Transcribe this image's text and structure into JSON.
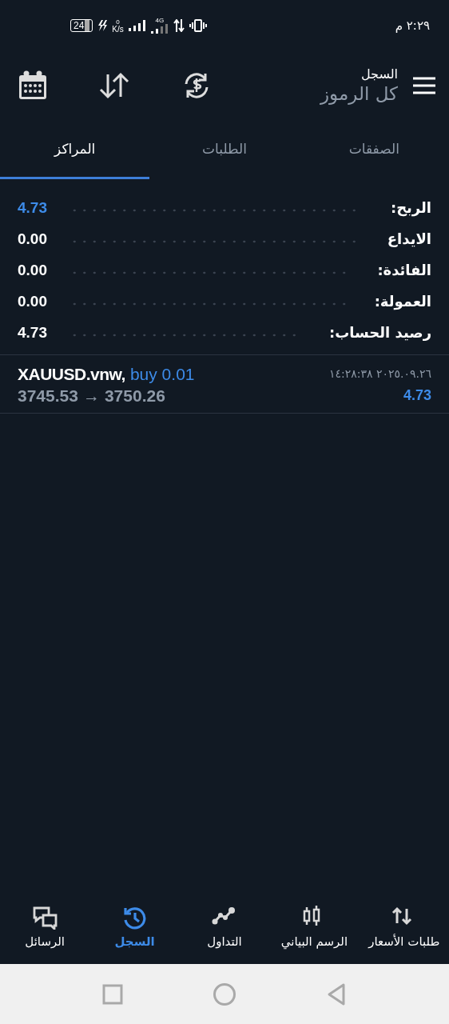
{
  "status_bar": {
    "time": "٢:٢٩ م",
    "battery": "24",
    "speed_value": "0",
    "speed_unit": "K/s",
    "network": "4G"
  },
  "header": {
    "title": "السجل",
    "subtitle": "كل الرموز"
  },
  "tabs": [
    {
      "label": "الصفقات",
      "selected": false
    },
    {
      "label": "الطلبات",
      "selected": false
    },
    {
      "label": "المراكز",
      "selected": true
    }
  ],
  "summary": [
    {
      "label": "الربح:",
      "value": "4.73",
      "highlight": true
    },
    {
      "label": "الايداع",
      "value": "0.00",
      "highlight": false
    },
    {
      "label": "الفائدة:",
      "value": "0.00",
      "highlight": false
    },
    {
      "label": "العمولة:",
      "value": "0.00",
      "highlight": false
    },
    {
      "label": "رصيد الحساب:",
      "value": "4.73",
      "highlight": false
    }
  ],
  "positions": [
    {
      "symbol": "XAUUSD.vnw,",
      "side": "buy 0.01",
      "open_price": "3745.53",
      "arrow": "→",
      "close_price": "3750.26",
      "time": "٢٠٢٥.٠٩.٢٦ ١٤:٢٨:٣٨",
      "profit": "4.73"
    }
  ],
  "bottom_nav": [
    {
      "kind": "quotes",
      "label": "طلبات الأسعار",
      "selected": false
    },
    {
      "kind": "chart",
      "label": "الرسم البياني",
      "selected": false
    },
    {
      "kind": "trade",
      "label": "التداول",
      "selected": false
    },
    {
      "kind": "history",
      "label": "السجل",
      "selected": true
    },
    {
      "kind": "messages",
      "label": "الرسائل",
      "selected": false
    }
  ]
}
